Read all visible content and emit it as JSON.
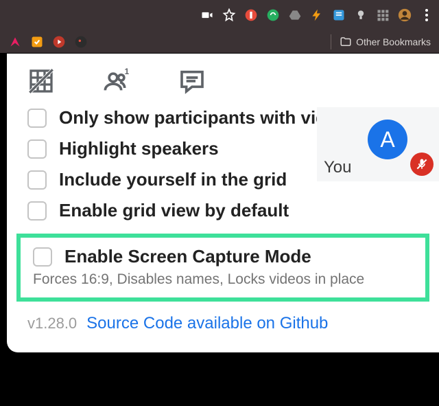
{
  "browser": {
    "other_bookmarks_label": "Other Bookmarks"
  },
  "self_tile": {
    "you_label": "You",
    "avatar_letter": "A"
  },
  "options": [
    {
      "label": "Only show participants with video"
    },
    {
      "label": "Highlight speakers"
    },
    {
      "label": "Include yourself in the grid"
    },
    {
      "label": "Enable grid view by default"
    }
  ],
  "highlighted_option": {
    "label": "Enable Screen Capture Mode",
    "hint": "Forces 16:9, Disables names, Locks videos in place"
  },
  "footer": {
    "version": "v1.28.0",
    "source_link": "Source Code available on Github"
  },
  "colors": {
    "highlight_border": "#3ee09a",
    "link": "#1a73e8",
    "mic_muted_bg": "#d93025",
    "toolbar_bg": "#3b3234"
  }
}
